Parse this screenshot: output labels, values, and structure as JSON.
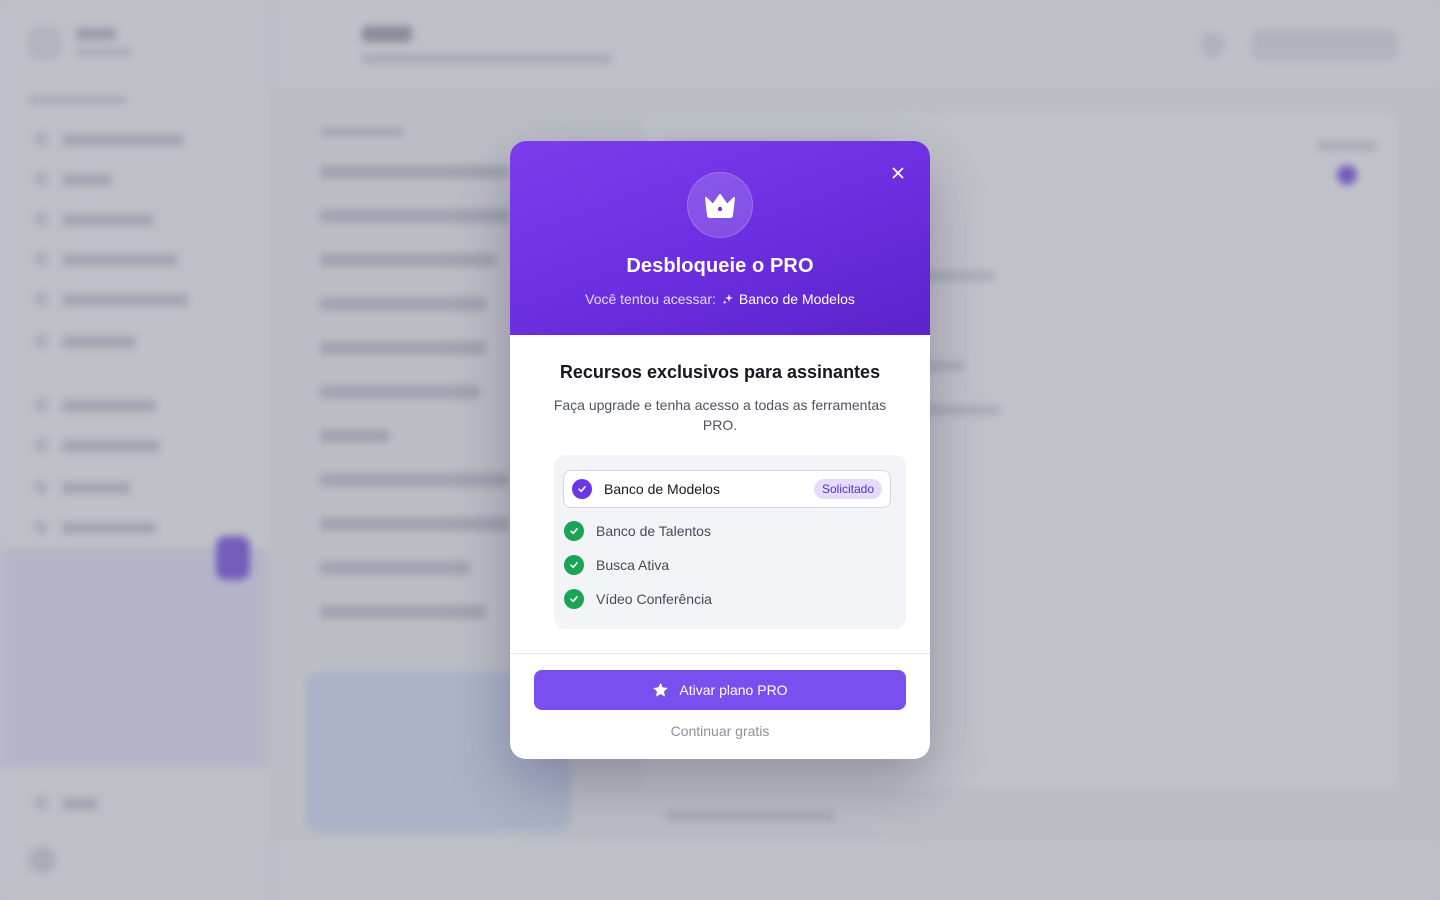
{
  "modal": {
    "title": "Desbloqueie o PRO",
    "attempt_prefix": "Você tentou acessar:",
    "attempt_feature": "Banco de Modelos",
    "section_title": "Recursos exclusivos para assinantes",
    "section_description": "Faça upgrade e tenha acesso a todas as ferramentas PRO.",
    "features": [
      {
        "label": "Banco de Modelos",
        "tag": "Solicitado",
        "selected": true
      },
      {
        "label": "Banco de Talentos",
        "selected": false
      },
      {
        "label": "Busca Ativa",
        "selected": false
      },
      {
        "label": "Vídeo Conferência",
        "selected": false
      }
    ],
    "primary_button": "Ativar plano PRO",
    "secondary_link": "Continuar gratis"
  },
  "colors": {
    "hero_gradient_start": "#7d3ded",
    "hero_gradient_end": "#5b23c9",
    "primary_button": "#7a4ff0",
    "check_selected": "#6d35e4",
    "check_included": "#1ca456",
    "tag_background": "#e4dcfb",
    "tag_text": "#5b2fc9"
  },
  "icons": {
    "close": "close-icon",
    "crown": "crown-icon",
    "sparkle": "sparkle-icon",
    "check": "check-icon",
    "star": "star-icon"
  }
}
